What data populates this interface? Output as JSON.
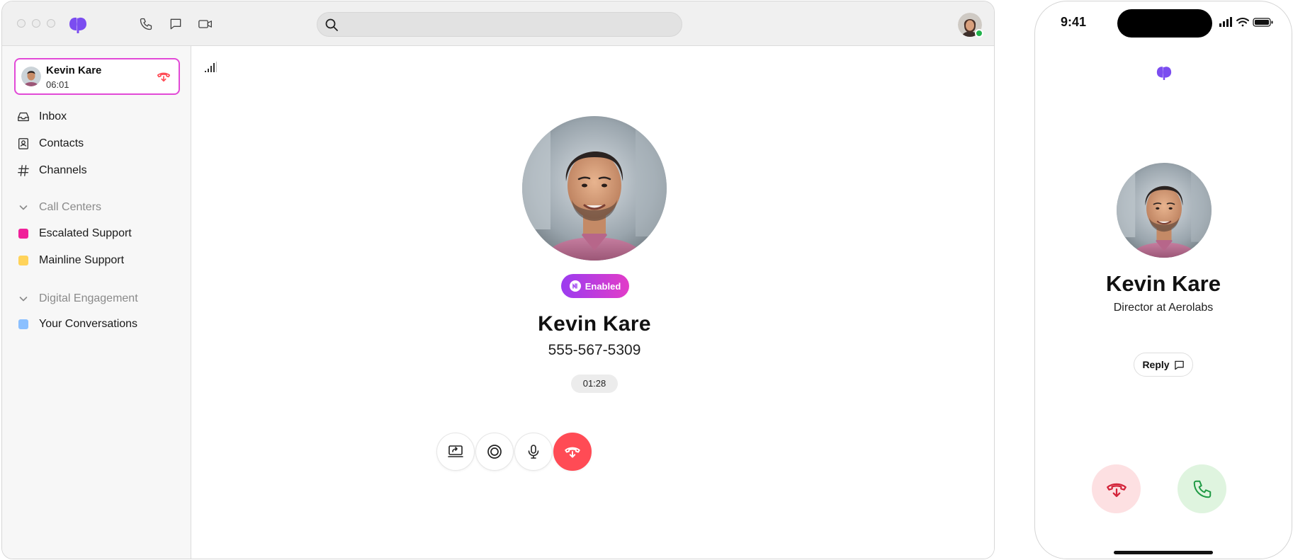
{
  "search": {
    "placeholder": ""
  },
  "active_call": {
    "name": "Kevin Kare",
    "elapsed": "06:01"
  },
  "nav": [
    {
      "label": "Inbox",
      "icon": "inbox-icon"
    },
    {
      "label": "Contacts",
      "icon": "contacts-icon"
    },
    {
      "label": "Channels",
      "icon": "hash-icon"
    }
  ],
  "call_centers": {
    "heading": "Call Centers",
    "items": [
      {
        "label": "Escalated Support",
        "color": "#f0219a"
      },
      {
        "label": "Mainline Support",
        "color": "#ffd35a"
      }
    ]
  },
  "digital_engagement": {
    "heading": "Digital Engagement",
    "items": [
      {
        "label": "Your Conversations",
        "color": "#8bc0ff"
      }
    ]
  },
  "call": {
    "badge": "Enabled",
    "name": "Kevin Kare",
    "phone": "555-567-5309",
    "duration": "01:28"
  },
  "mobile": {
    "time": "9:41",
    "name": "Kevin Kare",
    "title": "Director at Aerolabs",
    "reply_label": "Reply"
  },
  "colors": {
    "brand": "#7b4df0",
    "end_call": "#ff4b55",
    "accept": "#1f9a44",
    "active_border": "#e24ad7"
  }
}
